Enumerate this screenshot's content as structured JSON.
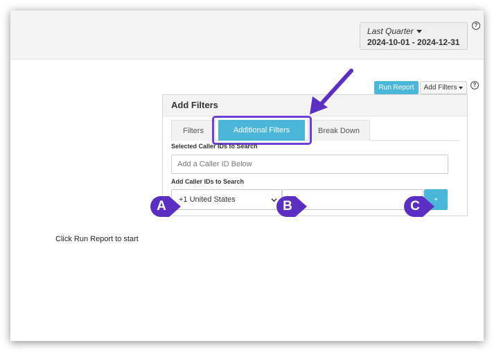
{
  "header": {
    "date_range": {
      "period": "Last Quarter",
      "dates": "2024-10-01 - 2024-12-31"
    },
    "help_symbol": "?"
  },
  "toolbar": {
    "run_report_label": "Run Report",
    "add_filters_label": "Add Filters",
    "help_symbol": "?"
  },
  "panel": {
    "title": "Add Filters",
    "tabs": [
      {
        "label": "Filters",
        "active": false
      },
      {
        "label": "Additional Filters",
        "active": true
      },
      {
        "label": "Break Down",
        "active": false
      }
    ],
    "selected_label": "Selected Caller IDs to Search",
    "selected_placeholder": "Add a Caller ID Below",
    "add_label": "Add Caller IDs to Search",
    "country_value": "+1 United States",
    "number_value": "",
    "add_button_label": "+"
  },
  "status_text": "Click Run Report to start",
  "annotations": {
    "callouts": [
      {
        "label": "A"
      },
      {
        "label": "B"
      },
      {
        "label": "C"
      }
    ],
    "accent_color": "#5b2fc2",
    "button_color": "#4cb6d8"
  }
}
